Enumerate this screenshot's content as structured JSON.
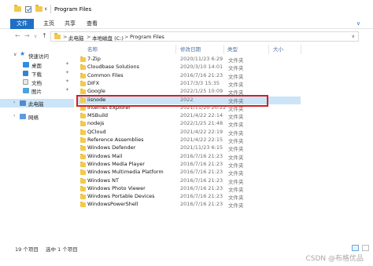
{
  "window": {
    "title": "Program Files",
    "quick_access_arrow": "∨"
  },
  "ribbon": {
    "tabs": [
      "文件",
      "主页",
      "共享",
      "查看"
    ]
  },
  "nav": {
    "back": "←",
    "forward": "→",
    "recent": "∨",
    "up": "↑",
    "breadcrumb": [
      "此电脑",
      "本地磁盘 (C:)",
      "Program Files"
    ],
    "separator": ">"
  },
  "sidebar": {
    "items": [
      {
        "label": "快速访问",
        "icon": "star-icon"
      },
      {
        "label": "桌面",
        "icon": "desktop-icon",
        "pinned": true
      },
      {
        "label": "下载",
        "icon": "download-icon",
        "pinned": true
      },
      {
        "label": "文档",
        "icon": "documents-icon",
        "pinned": true
      },
      {
        "label": "图片",
        "icon": "pictures-icon",
        "pinned": true
      },
      {
        "label": "此电脑",
        "icon": "computer-icon",
        "selected": true
      },
      {
        "label": "网络",
        "icon": "network-icon"
      }
    ]
  },
  "columns": {
    "name": "名称",
    "date": "修改日期",
    "type": "类型",
    "size": "大小"
  },
  "files": [
    {
      "name": "7-Zip",
      "date": "2020/11/23 6:29",
      "type": "文件夹"
    },
    {
      "name": "Cloudbase Solutions",
      "date": "2020/3/10 14:01",
      "type": "文件夹"
    },
    {
      "name": "Common Files",
      "date": "2016/7/16 21:23",
      "type": "文件夹"
    },
    {
      "name": "DIFX",
      "date": "2017/3/3 15:35",
      "type": "文件夹"
    },
    {
      "name": "Google",
      "date": "2022/1/25 10:09",
      "type": "文件夹"
    },
    {
      "name": "iisnode",
      "date": "2022/1/25 22:21",
      "type": "文件夹",
      "selected": true
    },
    {
      "name": "Internet Explorer",
      "date": "2021/11/20 20:22",
      "type": "文件夹"
    },
    {
      "name": "MSBuild",
      "date": "2021/4/22 22:14",
      "type": "文件夹"
    },
    {
      "name": "nodejs",
      "date": "2022/1/25 21:48",
      "type": "文件夹"
    },
    {
      "name": "QCloud",
      "date": "2021/4/22 22:19",
      "type": "文件夹"
    },
    {
      "name": "Reference Assemblies",
      "date": "2021/4/22 22:15",
      "type": "文件夹"
    },
    {
      "name": "Windows Defender",
      "date": "2021/11/23 6:15",
      "type": "文件夹"
    },
    {
      "name": "Windows Mail",
      "date": "2016/7/16 21:23",
      "type": "文件夹"
    },
    {
      "name": "Windows Media Player",
      "date": "2016/7/16 21:23",
      "type": "文件夹"
    },
    {
      "name": "Windows Multimedia Platform",
      "date": "2016/7/16 21:23",
      "type": "文件夹"
    },
    {
      "name": "Windows NT",
      "date": "2016/7/16 21:23",
      "type": "文件夹"
    },
    {
      "name": "Windows Photo Viewer",
      "date": "2016/7/16 21:23",
      "type": "文件夹"
    },
    {
      "name": "Windows Portable Devices",
      "date": "2016/7/16 21:23",
      "type": "文件夹"
    },
    {
      "name": "WindowsPowerShell",
      "date": "2016/7/16 21:23",
      "type": "文件夹"
    }
  ],
  "status": {
    "count": "19 个项目",
    "selected": "选中 1 个项目"
  },
  "watermark": "CSDN @布格优品",
  "colors": {
    "accent": "#1f6fc4",
    "selection": "#cce4f7",
    "highlight": "#d42020",
    "folder": "#f2c94c"
  }
}
